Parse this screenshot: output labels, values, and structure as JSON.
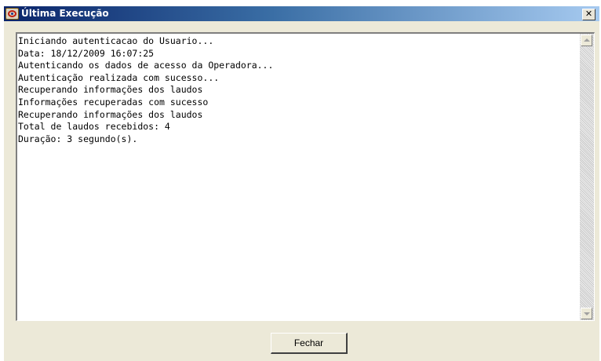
{
  "window": {
    "title": "Última Execução",
    "close_glyph": "✕",
    "app_icon": "app-logo-icon"
  },
  "log": {
    "lines": [
      "Iniciando autenticacao do Usuario...",
      "Data: 18/12/2009 16:07:25",
      "Autenticando os dados de acesso da Operadora...",
      "Autenticação realizada com sucesso...",
      "Recuperando informações dos laudos",
      "Informações recuperadas com sucesso",
      "Recuperando informações dos laudos",
      "Total de laudos recebidos: 4",
      "Duração: 3 segundo(s)."
    ]
  },
  "scrollbar": {
    "up_icon": "scroll-up-arrow-icon",
    "down_icon": "scroll-down-arrow-icon"
  },
  "actions": {
    "close_label": "Fechar"
  },
  "colors": {
    "titlebar_start": "#0a246a",
    "titlebar_end": "#a6caf0",
    "dialog_bg": "#ece9d8",
    "log_bg": "#ffffff"
  }
}
